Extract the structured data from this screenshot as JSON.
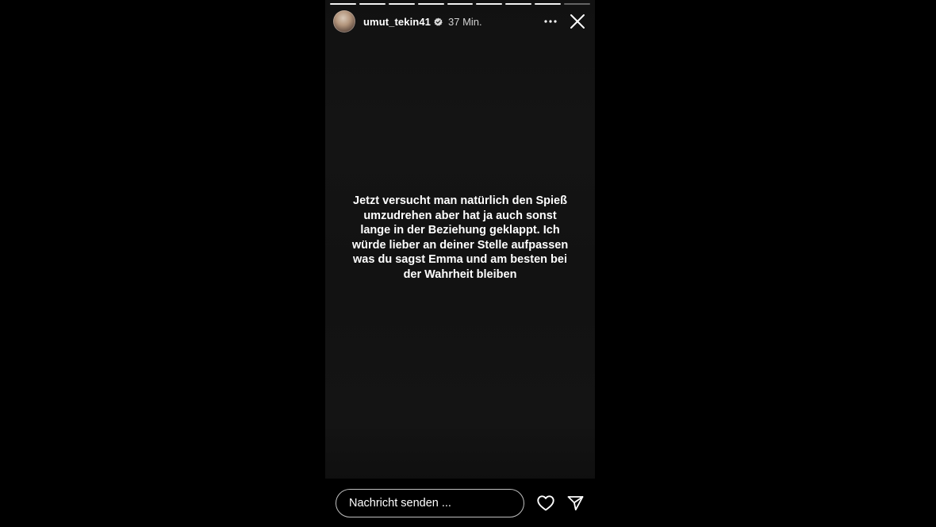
{
  "header": {
    "username": "umut_tekin41",
    "time": "37 Min.",
    "progress_segments": 9,
    "active_segment": 9
  },
  "story": {
    "text": "Jetzt versucht man natürlich den Spieß\numzudrehen aber hat ja auch sonst\nlange in der Beziehung geklappt. Ich\nwürde lieber an deiner Stelle aufpassen\nwas du sagst Emma und am besten bei\nder Wahrheit bleiben"
  },
  "footer": {
    "message_placeholder": "Nachricht senden ..."
  },
  "icons": {
    "verified": "verified-badge-icon",
    "more": "more-options-icon",
    "close": "close-icon",
    "like": "heart-icon",
    "send": "send-icon"
  },
  "colors": {
    "background": "#000000",
    "story_background": "#121212",
    "text": "#ffffff"
  }
}
